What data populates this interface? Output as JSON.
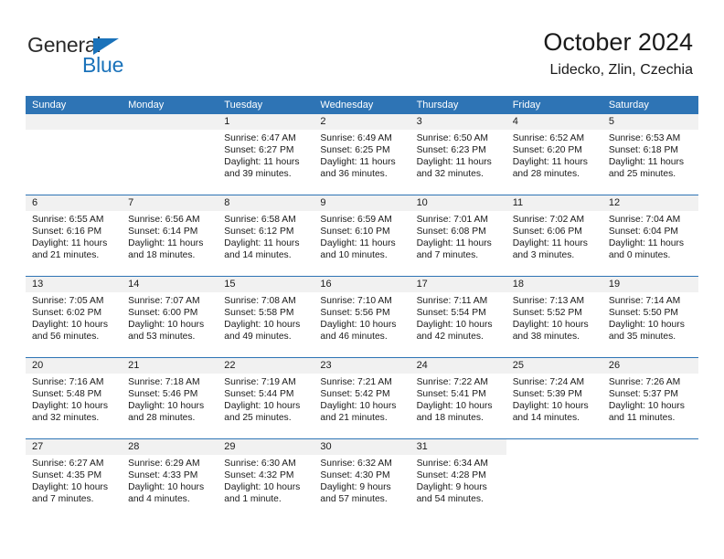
{
  "brand": {
    "name_part1": "General",
    "name_part2": "Blue",
    "accent_color": "#1a72ba"
  },
  "header": {
    "title": "October 2024",
    "subtitle": "Lidecko, Zlin, Czechia"
  },
  "theme": {
    "header_blue": "#2e74b5",
    "day_band_gray": "#f1f1f1"
  },
  "weekdays": [
    "Sunday",
    "Monday",
    "Tuesday",
    "Wednesday",
    "Thursday",
    "Friday",
    "Saturday"
  ],
  "weeks": [
    [
      {
        "day": "",
        "lines": []
      },
      {
        "day": "",
        "lines": []
      },
      {
        "day": "1",
        "lines": [
          "Sunrise: 6:47 AM",
          "Sunset: 6:27 PM",
          "Daylight: 11 hours",
          "and 39 minutes."
        ]
      },
      {
        "day": "2",
        "lines": [
          "Sunrise: 6:49 AM",
          "Sunset: 6:25 PM",
          "Daylight: 11 hours",
          "and 36 minutes."
        ]
      },
      {
        "day": "3",
        "lines": [
          "Sunrise: 6:50 AM",
          "Sunset: 6:23 PM",
          "Daylight: 11 hours",
          "and 32 minutes."
        ]
      },
      {
        "day": "4",
        "lines": [
          "Sunrise: 6:52 AM",
          "Sunset: 6:20 PM",
          "Daylight: 11 hours",
          "and 28 minutes."
        ]
      },
      {
        "day": "5",
        "lines": [
          "Sunrise: 6:53 AM",
          "Sunset: 6:18 PM",
          "Daylight: 11 hours",
          "and 25 minutes."
        ]
      }
    ],
    [
      {
        "day": "6",
        "lines": [
          "Sunrise: 6:55 AM",
          "Sunset: 6:16 PM",
          "Daylight: 11 hours",
          "and 21 minutes."
        ]
      },
      {
        "day": "7",
        "lines": [
          "Sunrise: 6:56 AM",
          "Sunset: 6:14 PM",
          "Daylight: 11 hours",
          "and 18 minutes."
        ]
      },
      {
        "day": "8",
        "lines": [
          "Sunrise: 6:58 AM",
          "Sunset: 6:12 PM",
          "Daylight: 11 hours",
          "and 14 minutes."
        ]
      },
      {
        "day": "9",
        "lines": [
          "Sunrise: 6:59 AM",
          "Sunset: 6:10 PM",
          "Daylight: 11 hours",
          "and 10 minutes."
        ]
      },
      {
        "day": "10",
        "lines": [
          "Sunrise: 7:01 AM",
          "Sunset: 6:08 PM",
          "Daylight: 11 hours",
          "and 7 minutes."
        ]
      },
      {
        "day": "11",
        "lines": [
          "Sunrise: 7:02 AM",
          "Sunset: 6:06 PM",
          "Daylight: 11 hours",
          "and 3 minutes."
        ]
      },
      {
        "day": "12",
        "lines": [
          "Sunrise: 7:04 AM",
          "Sunset: 6:04 PM",
          "Daylight: 11 hours",
          "and 0 minutes."
        ]
      }
    ],
    [
      {
        "day": "13",
        "lines": [
          "Sunrise: 7:05 AM",
          "Sunset: 6:02 PM",
          "Daylight: 10 hours",
          "and 56 minutes."
        ]
      },
      {
        "day": "14",
        "lines": [
          "Sunrise: 7:07 AM",
          "Sunset: 6:00 PM",
          "Daylight: 10 hours",
          "and 53 minutes."
        ]
      },
      {
        "day": "15",
        "lines": [
          "Sunrise: 7:08 AM",
          "Sunset: 5:58 PM",
          "Daylight: 10 hours",
          "and 49 minutes."
        ]
      },
      {
        "day": "16",
        "lines": [
          "Sunrise: 7:10 AM",
          "Sunset: 5:56 PM",
          "Daylight: 10 hours",
          "and 46 minutes."
        ]
      },
      {
        "day": "17",
        "lines": [
          "Sunrise: 7:11 AM",
          "Sunset: 5:54 PM",
          "Daylight: 10 hours",
          "and 42 minutes."
        ]
      },
      {
        "day": "18",
        "lines": [
          "Sunrise: 7:13 AM",
          "Sunset: 5:52 PM",
          "Daylight: 10 hours",
          "and 38 minutes."
        ]
      },
      {
        "day": "19",
        "lines": [
          "Sunrise: 7:14 AM",
          "Sunset: 5:50 PM",
          "Daylight: 10 hours",
          "and 35 minutes."
        ]
      }
    ],
    [
      {
        "day": "20",
        "lines": [
          "Sunrise: 7:16 AM",
          "Sunset: 5:48 PM",
          "Daylight: 10 hours",
          "and 32 minutes."
        ]
      },
      {
        "day": "21",
        "lines": [
          "Sunrise: 7:18 AM",
          "Sunset: 5:46 PM",
          "Daylight: 10 hours",
          "and 28 minutes."
        ]
      },
      {
        "day": "22",
        "lines": [
          "Sunrise: 7:19 AM",
          "Sunset: 5:44 PM",
          "Daylight: 10 hours",
          "and 25 minutes."
        ]
      },
      {
        "day": "23",
        "lines": [
          "Sunrise: 7:21 AM",
          "Sunset: 5:42 PM",
          "Daylight: 10 hours",
          "and 21 minutes."
        ]
      },
      {
        "day": "24",
        "lines": [
          "Sunrise: 7:22 AM",
          "Sunset: 5:41 PM",
          "Daylight: 10 hours",
          "and 18 minutes."
        ]
      },
      {
        "day": "25",
        "lines": [
          "Sunrise: 7:24 AM",
          "Sunset: 5:39 PM",
          "Daylight: 10 hours",
          "and 14 minutes."
        ]
      },
      {
        "day": "26",
        "lines": [
          "Sunrise: 7:26 AM",
          "Sunset: 5:37 PM",
          "Daylight: 10 hours",
          "and 11 minutes."
        ]
      }
    ],
    [
      {
        "day": "27",
        "lines": [
          "Sunrise: 6:27 AM",
          "Sunset: 4:35 PM",
          "Daylight: 10 hours",
          "and 7 minutes."
        ]
      },
      {
        "day": "28",
        "lines": [
          "Sunrise: 6:29 AM",
          "Sunset: 4:33 PM",
          "Daylight: 10 hours",
          "and 4 minutes."
        ]
      },
      {
        "day": "29",
        "lines": [
          "Sunrise: 6:30 AM",
          "Sunset: 4:32 PM",
          "Daylight: 10 hours",
          "and 1 minute."
        ]
      },
      {
        "day": "30",
        "lines": [
          "Sunrise: 6:32 AM",
          "Sunset: 4:30 PM",
          "Daylight: 9 hours",
          "and 57 minutes."
        ]
      },
      {
        "day": "31",
        "lines": [
          "Sunrise: 6:34 AM",
          "Sunset: 4:28 PM",
          "Daylight: 9 hours",
          "and 54 minutes."
        ]
      },
      {
        "day": "",
        "lines": []
      },
      {
        "day": "",
        "lines": []
      }
    ]
  ]
}
